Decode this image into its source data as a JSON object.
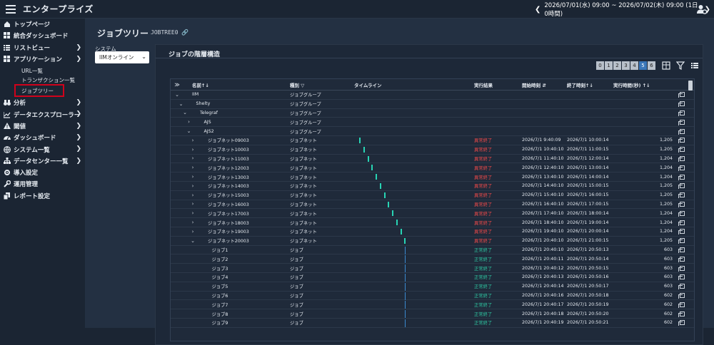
{
  "header": {
    "title": "エンタープライズ",
    "date_range": "2026/07/01(水) 09:00 ~ 2026/07/02(木) 09:00 (1日 0時間)",
    "prev": "❮",
    "next": "❯"
  },
  "sidebar": {
    "items": [
      {
        "label": "トップページ",
        "icon": "home-icon"
      },
      {
        "label": "統合ダッシュボード",
        "icon": "dashboard-grid-icon"
      },
      {
        "label": "リストビュー",
        "icon": "list-icon",
        "chev": "❯"
      },
      {
        "label": "アプリケーション",
        "icon": "apps-icon",
        "chev": "❯"
      }
    ],
    "subitems": [
      {
        "label": "URL一覧"
      },
      {
        "label": "トランザクション一覧"
      },
      {
        "label": "ジョブツリー"
      }
    ],
    "items2": [
      {
        "label": "分析",
        "icon": "binoculars-icon",
        "chev": "❯"
      },
      {
        "label": "データエクスプローラー",
        "icon": "chart-icon",
        "chev": "❯"
      },
      {
        "label": "閾値",
        "icon": "warning-icon",
        "chev": "❯"
      },
      {
        "label": "ダッシュボード",
        "icon": "gauge-icon",
        "chev": "❯"
      },
      {
        "label": "システム一覧",
        "icon": "globe-icon",
        "chev": "❯"
      },
      {
        "label": "データセンター一覧",
        "icon": "sitemap-icon",
        "chev": "❯"
      },
      {
        "label": "導入設定",
        "icon": "gear-icon"
      },
      {
        "label": "運用管理",
        "icon": "wrench-icon"
      },
      {
        "label": "レポート設定",
        "icon": "copy-icon"
      }
    ]
  },
  "page": {
    "title": "ジョブツリー",
    "subtitle": "JOBTREE0",
    "system_label": "システム",
    "system_value": "IIMオンライン",
    "panel_title": "ジョブの階層構造"
  },
  "levels": [
    "0",
    "1",
    "2",
    "3",
    "4",
    "5",
    "6"
  ],
  "active_level": "5",
  "columns": {
    "name": "名前↑↓",
    "type": "種別 ▽",
    "timeline": "タイムライン",
    "result": "実行結果",
    "start": "開始時刻 ⇵",
    "end": "終了時刻↑↓",
    "duration": "実行時間(秒) ↑↓",
    "expand": "≫"
  },
  "rows": [
    {
      "exp": "⌄",
      "name": "IIM",
      "indent": 0,
      "type": "ジョブグループ",
      "res": "",
      "st": "",
      "en": "",
      "dur": "",
      "bar": null
    },
    {
      "exp": "⌄",
      "name": "Shelty",
      "indent": 1,
      "type": "ジョブグループ",
      "res": "",
      "st": "",
      "en": "",
      "dur": "",
      "bar": null
    },
    {
      "exp": "⌄",
      "name": "Telegraf",
      "indent": 2,
      "type": "ジョブグループ",
      "res": "",
      "st": "",
      "en": "",
      "dur": "",
      "bar": null
    },
    {
      "exp": "›",
      "name": "AJS",
      "indent": 3,
      "type": "ジョブグループ",
      "res": "",
      "st": "",
      "en": "",
      "dur": "",
      "bar": null
    },
    {
      "exp": "⌄",
      "name": "AJS2",
      "indent": 3,
      "type": "ジョブグループ",
      "res": "",
      "st": "",
      "en": "",
      "dur": "",
      "bar": null
    },
    {
      "exp": "›",
      "name": "ジョブネット09003",
      "indent": 4,
      "type": "ジョブネット",
      "res": "異常終了",
      "st": "2026/7/1 9:40:09",
      "en": "2026/7/1 10:00:14",
      "dur": "1,205",
      "bar": 0
    },
    {
      "exp": "›",
      "name": "ジョブネット10003",
      "indent": 4,
      "type": "ジョブネット",
      "res": "異常終了",
      "st": "2026/7/1 10:40:10",
      "en": "2026/7/1 11:00:15",
      "dur": "1,205",
      "bar": 1
    },
    {
      "exp": "›",
      "name": "ジョブネット11003",
      "indent": 4,
      "type": "ジョブネット",
      "res": "異常終了",
      "st": "2026/7/1 11:40:10",
      "en": "2026/7/1 12:00:14",
      "dur": "1,204",
      "bar": 2
    },
    {
      "exp": "›",
      "name": "ジョブネット12003",
      "indent": 4,
      "type": "ジョブネット",
      "res": "異常終了",
      "st": "2026/7/1 12:40:10",
      "en": "2026/7/1 13:00:14",
      "dur": "1,204",
      "bar": 3
    },
    {
      "exp": "›",
      "name": "ジョブネット13003",
      "indent": 4,
      "type": "ジョブネット",
      "res": "異常終了",
      "st": "2026/7/1 13:40:10",
      "en": "2026/7/1 14:00:14",
      "dur": "1,204",
      "bar": 4
    },
    {
      "exp": "›",
      "name": "ジョブネット14003",
      "indent": 4,
      "type": "ジョブネット",
      "res": "異常終了",
      "st": "2026/7/1 14:40:10",
      "en": "2026/7/1 15:00:15",
      "dur": "1,205",
      "bar": 5
    },
    {
      "exp": "›",
      "name": "ジョブネット15003",
      "indent": 4,
      "type": "ジョブネット",
      "res": "異常終了",
      "st": "2026/7/1 15:40:10",
      "en": "2026/7/1 16:00:15",
      "dur": "1,205",
      "bar": 6
    },
    {
      "exp": "›",
      "name": "ジョブネット16003",
      "indent": 4,
      "type": "ジョブネット",
      "res": "異常終了",
      "st": "2026/7/1 16:40:10",
      "en": "2026/7/1 17:00:15",
      "dur": "1,205",
      "bar": 7
    },
    {
      "exp": "›",
      "name": "ジョブネット17003",
      "indent": 4,
      "type": "ジョブネット",
      "res": "異常終了",
      "st": "2026/7/1 17:40:10",
      "en": "2026/7/1 18:00:14",
      "dur": "1,204",
      "bar": 8
    },
    {
      "exp": "›",
      "name": "ジョブネット18003",
      "indent": 4,
      "type": "ジョブネット",
      "res": "異常終了",
      "st": "2026/7/1 18:40:10",
      "en": "2026/7/1 19:00:14",
      "dur": "1,204",
      "bar": 9
    },
    {
      "exp": "›",
      "name": "ジョブネット19003",
      "indent": 4,
      "type": "ジョブネット",
      "res": "異常終了",
      "st": "2026/7/1 19:40:10",
      "en": "2026/7/1 20:00:14",
      "dur": "1,204",
      "bar": 10
    },
    {
      "exp": "⌄",
      "name": "ジョブネット20003",
      "indent": 4,
      "type": "ジョブネット",
      "res": "異常終了",
      "st": "2026/7/1 20:40:10",
      "en": "2026/7/1 21:00:15",
      "dur": "1,205",
      "bar": 11
    },
    {
      "exp": "",
      "name": "ジョブ1",
      "indent": 5,
      "type": "ジョブ",
      "res": "正常終了",
      "st": "2026/7/1 20:40:10",
      "en": "2026/7/1 20:50:13",
      "dur": "603",
      "bar": 11,
      "thin": true
    },
    {
      "exp": "",
      "name": "ジョブ2",
      "indent": 5,
      "type": "ジョブ",
      "res": "正常終了",
      "st": "2026/7/1 20:40:11",
      "en": "2026/7/1 20:50:14",
      "dur": "603",
      "bar": 11,
      "thin": true
    },
    {
      "exp": "",
      "name": "ジョブ3",
      "indent": 5,
      "type": "ジョブ",
      "res": "正常終了",
      "st": "2026/7/1 20:40:12",
      "en": "2026/7/1 20:50:15",
      "dur": "603",
      "bar": 11,
      "thin": true
    },
    {
      "exp": "",
      "name": "ジョブ4",
      "indent": 5,
      "type": "ジョブ",
      "res": "正常終了",
      "st": "2026/7/1 20:40:13",
      "en": "2026/7/1 20:50:16",
      "dur": "603",
      "bar": 11,
      "thin": true
    },
    {
      "exp": "",
      "name": "ジョブ5",
      "indent": 5,
      "type": "ジョブ",
      "res": "正常終了",
      "st": "2026/7/1 20:40:14",
      "en": "2026/7/1 20:50:17",
      "dur": "603",
      "bar": 11,
      "thin": true
    },
    {
      "exp": "",
      "name": "ジョブ6",
      "indent": 5,
      "type": "ジョブ",
      "res": "正常終了",
      "st": "2026/7/1 20:40:16",
      "en": "2026/7/1 20:50:18",
      "dur": "602",
      "bar": 11,
      "thin": true
    },
    {
      "exp": "",
      "name": "ジョブ7",
      "indent": 5,
      "type": "ジョブ",
      "res": "正常終了",
      "st": "2026/7/1 20:40:17",
      "en": "2026/7/1 20:50:19",
      "dur": "602",
      "bar": 11,
      "thin": true
    },
    {
      "exp": "",
      "name": "ジョブ8",
      "indent": 5,
      "type": "ジョブ",
      "res": "正常終了",
      "st": "2026/7/1 20:40:18",
      "en": "2026/7/1 20:50:20",
      "dur": "602",
      "bar": 11,
      "thin": true
    },
    {
      "exp": "",
      "name": "ジョブ9",
      "indent": 5,
      "type": "ジョブ",
      "res": "正常終了",
      "st": "2026/7/1 20:40:19",
      "en": "2026/7/1 20:50:21",
      "dur": "602",
      "bar": 11,
      "thin": true
    }
  ]
}
